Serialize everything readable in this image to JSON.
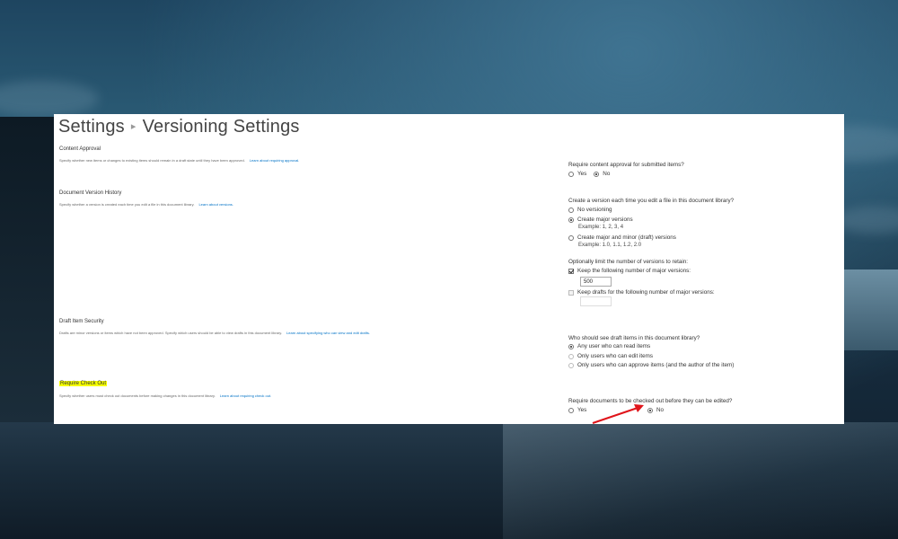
{
  "breadcrumb": {
    "root": "Settings",
    "separator": "▸",
    "current": "Versioning Settings"
  },
  "sections": {
    "content_approval": {
      "title": "Content Approval",
      "description": "Specify whether new items or changes to existing items should remain in a draft state until they have been approved.",
      "link": "Learn about requiring approval.",
      "question": "Require content approval for submitted items?",
      "options": [
        "Yes",
        "No"
      ],
      "selected": "No"
    },
    "version_history": {
      "title": "Document Version History",
      "description": "Specify whether a version is created each time you edit a file in this document library.",
      "link": "Learn about versions.",
      "question": "Create a version each time you edit a file in this document library?",
      "options": [
        {
          "label": "No versioning",
          "example": ""
        },
        {
          "label": "Create major versions",
          "example": "Example: 1, 2, 3, 4"
        },
        {
          "label": "Create major and minor (draft) versions",
          "example": "Example: 1.0, 1.1, 1.2, 2.0"
        }
      ],
      "selected": "Create major versions",
      "limit_question": "Optionally limit the number of versions to retain:",
      "keep_major_label": "Keep the following number of major versions:",
      "keep_major_checked": true,
      "keep_major_value": "500",
      "keep_drafts_label": "Keep drafts for the following number of major versions:",
      "keep_drafts_checked": false,
      "keep_drafts_value": ""
    },
    "draft_security": {
      "title": "Draft Item Security",
      "description": "Drafts are minor versions or items which have not been approved. Specify which users should be able to view drafts in this document library.",
      "link": "Learn about specifying who can view and edit drafts.",
      "question": "Who should see draft items in this document library?",
      "options": [
        "Any user who can read items",
        "Only users who can edit items",
        "Only users who can approve items (and the author of the item)"
      ],
      "selected": "Any user who can read items"
    },
    "require_checkout": {
      "title": "Require Check Out",
      "description": "Specify whether users must check out documents before making changes in this document library.",
      "link": "Learn about requiring check out.",
      "question": "Require documents to be checked out before they can be edited?",
      "options": [
        "Yes",
        "No"
      ],
      "selected": "No"
    }
  },
  "colors": {
    "link": "#0072c6",
    "highlight": "#f6ff00",
    "arrow": "#e0151b"
  }
}
